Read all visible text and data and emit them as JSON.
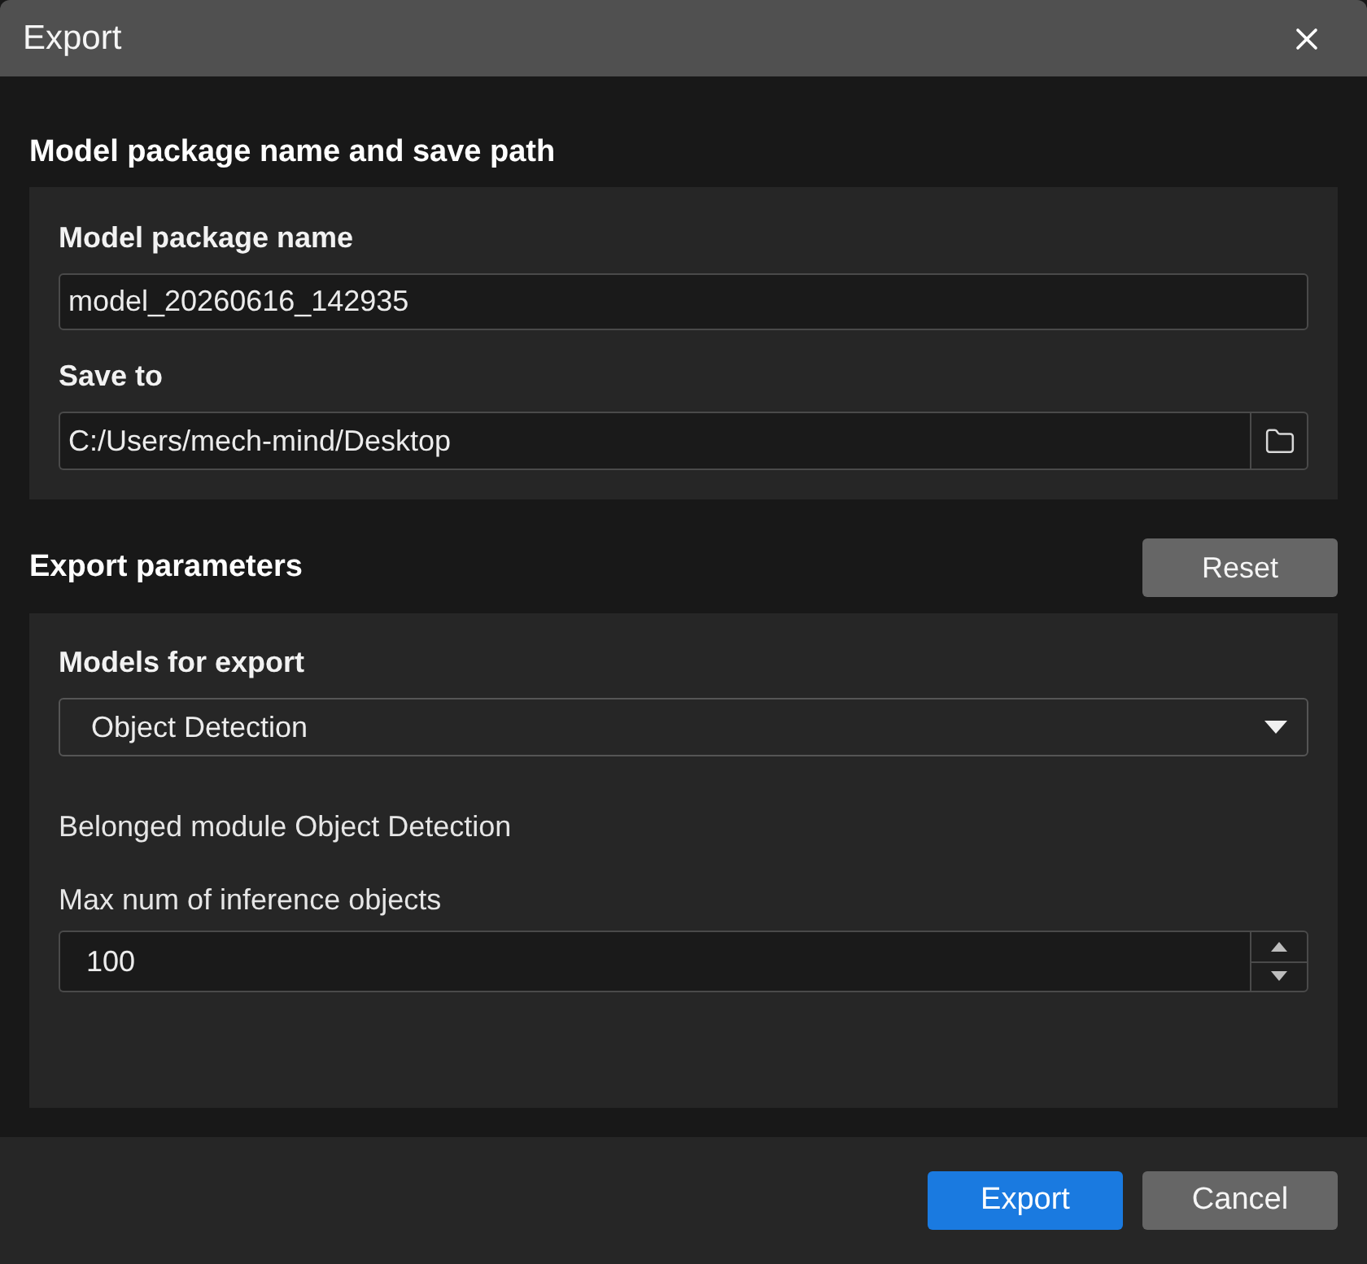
{
  "window": {
    "title": "Export"
  },
  "sections": [
    {
      "title": "Model package name and save path",
      "fields": [
        {
          "kind": "text",
          "label": "Model package name",
          "value": "model_20260616_142935"
        },
        {
          "kind": "path",
          "label": "Save to",
          "value": "C:/Users/mech-mind/Desktop"
        }
      ]
    },
    {
      "title": "Export parameters",
      "action": "Reset",
      "fields": [
        {
          "kind": "select",
          "label": "Models for export",
          "value": "Object Detection"
        },
        {
          "kind": "note",
          "text": "Belonged module Object Detection"
        },
        {
          "kind": "number",
          "label": "Max num of inference objects",
          "value": "100"
        }
      ]
    }
  ],
  "buttons": [
    {
      "label": "Export",
      "primary": true
    },
    {
      "label": "Cancel",
      "primary": false
    }
  ]
}
